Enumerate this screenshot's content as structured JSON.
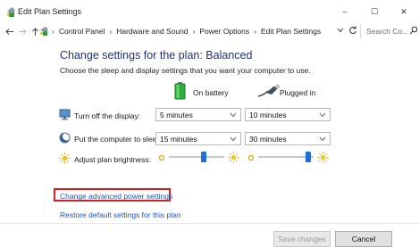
{
  "window": {
    "title": "Edit Plan Settings",
    "minimize_glyph": "–",
    "maximize_glyph": "☐",
    "close_glyph": "✕"
  },
  "address_bar": {
    "breadcrumb": [
      "Control Panel",
      "Hardware and Sound",
      "Power Options",
      "Edit Plan Settings"
    ],
    "separator": "›",
    "search_placeholder": "Search Co..."
  },
  "page": {
    "title": "Change settings for the plan: Balanced",
    "subtitle": "Choose the sleep and display settings that you want your computer to use.",
    "columns": {
      "battery": "On battery",
      "plugged": "Plugged in"
    },
    "rows": [
      {
        "label": "Turn off the display:",
        "battery": "5 minutes",
        "plugged": "10 minutes",
        "icon": "monitor-icon"
      },
      {
        "label": "Put the computer to sleep:",
        "battery": "15 minutes",
        "plugged": "30 minutes",
        "icon": "sleep-moon-icon"
      }
    ],
    "brightness": {
      "label": "Adjust plan brightness:",
      "battery_level": 0.65,
      "plugged_level": 0.95
    },
    "links": {
      "advanced": "Change advanced power settings",
      "restore": "Restore default settings for this plan"
    },
    "buttons": {
      "save": "Save changes",
      "cancel": "Cancel"
    }
  },
  "colors": {
    "title_blue": "#1e3287",
    "link_blue": "#1a56b8",
    "slider_thumb": "#1f6fd6",
    "highlight_red": "#d32020"
  }
}
